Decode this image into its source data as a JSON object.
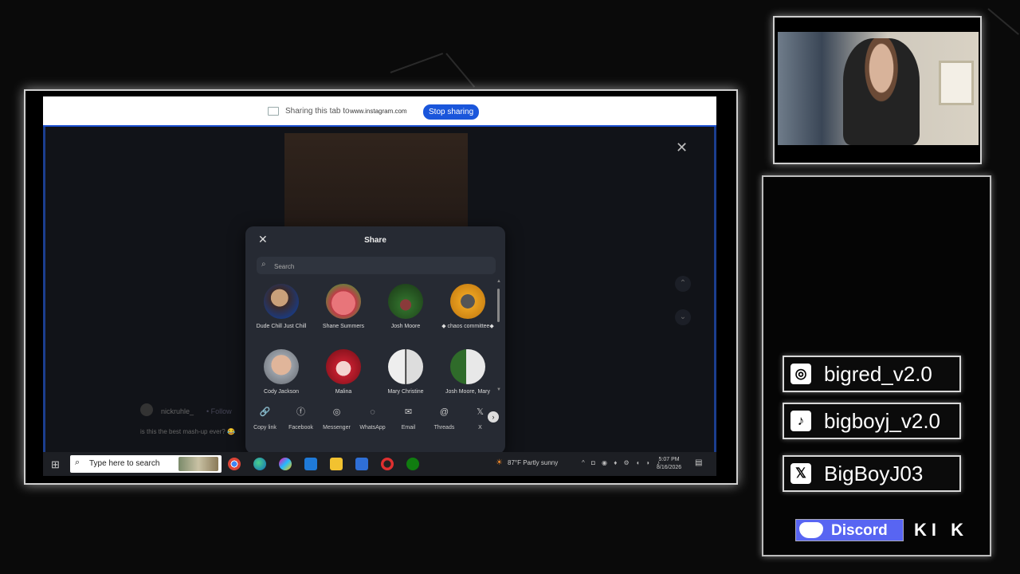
{
  "share_bar": {
    "sharing_text": "Sharing this tab to",
    "site": "www.instagram.com",
    "stop_label": "Stop sharing"
  },
  "post": {
    "comment_user": "nickruhle_",
    "comment_follow": "• Follow",
    "comment_text": "is this the best mash-up ever? 😂"
  },
  "share_modal": {
    "title": "Share",
    "search_placeholder": "Search",
    "contacts": [
      {
        "name": "Dude Chill Just Chill"
      },
      {
        "name": "Shane Summers"
      },
      {
        "name": "Josh Moore"
      },
      {
        "name": "◆ chaos committee◆"
      },
      {
        "name": "Cody Jackson"
      },
      {
        "name": "Malina"
      },
      {
        "name": "Mary Christine"
      },
      {
        "name": "Josh Moore, Mary"
      }
    ],
    "apps": [
      {
        "label": "Copy link",
        "icon": "🔗"
      },
      {
        "label": "Facebook",
        "icon": "ⓕ"
      },
      {
        "label": "Messenger",
        "icon": "◎"
      },
      {
        "label": "WhatsApp",
        "icon": "◌"
      },
      {
        "label": "Email",
        "icon": "✉"
      },
      {
        "label": "Threads",
        "icon": "@"
      },
      {
        "label": "X",
        "icon": "𝕏"
      }
    ]
  },
  "taskbar": {
    "search_text": "Type here to search",
    "weather": "87°F  Partly sunny",
    "time": "5:07 PM",
    "date": "8/16/2026"
  },
  "socials": {
    "instagram": "bigred_v2.0",
    "tiktok": "bigboyj_v2.0",
    "x": "BigBoyJ03",
    "discord": "Discord",
    "kick": "KI K"
  },
  "colors": {
    "accent_blue": "#1a56db",
    "discord": "#5865f2"
  }
}
